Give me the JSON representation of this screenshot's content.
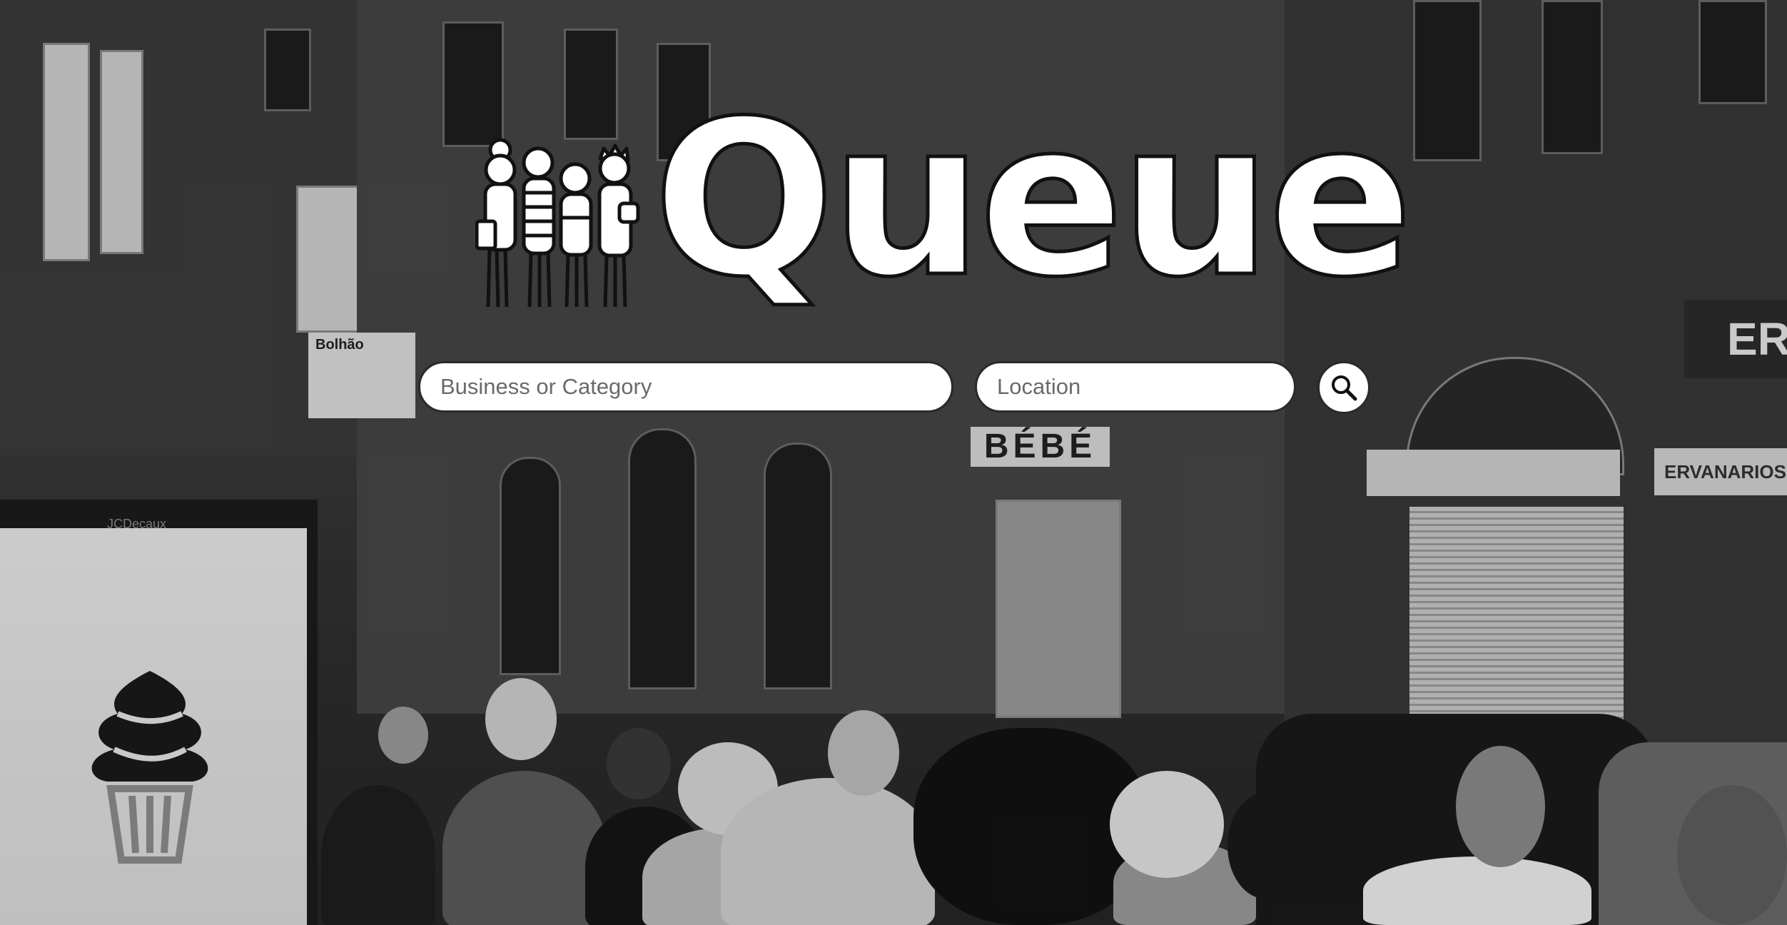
{
  "brand": {
    "name": "Queue",
    "logo_icon": "queue-people-icon"
  },
  "search": {
    "business_placeholder": "Business or Category",
    "business_value": "",
    "location_placeholder": "Location",
    "location_value": "",
    "button_icon": "search-icon"
  },
  "background": {
    "signs": {
      "bus_stop": "Bolhão",
      "bebe": "BÉBÉ",
      "erva": "ERVA",
      "ervanarios": "ERVANARIOS de A",
      "jcdecaux": "JCDecaux"
    }
  },
  "colors": {
    "field_bg": "#ffffff",
    "outline": "#2a2a2a",
    "logo_fill": "#ffffff"
  }
}
